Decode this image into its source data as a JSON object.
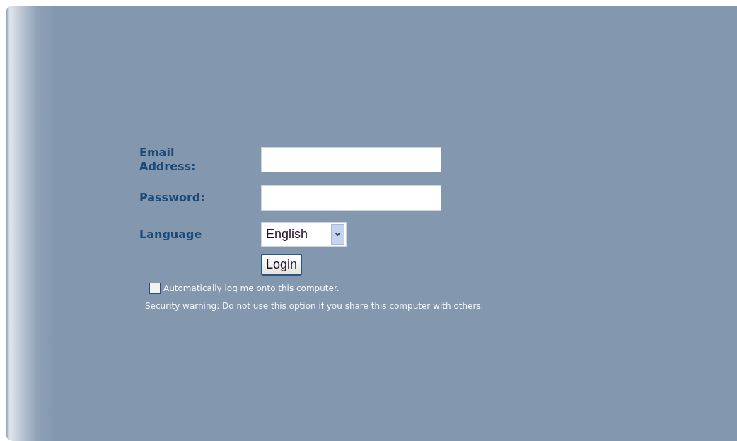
{
  "form": {
    "fields": [
      {
        "kind": "text",
        "label": "Email Address:"
      },
      {
        "kind": "password",
        "label": "Password:"
      },
      {
        "kind": "select",
        "label": "Language",
        "value": "English"
      }
    ],
    "login_button": "Login",
    "auto_login": {
      "label": "Automatically log me onto this computer.",
      "checked": false
    },
    "warning": "Security warning: Do not use this option if you share this computer with others."
  }
}
